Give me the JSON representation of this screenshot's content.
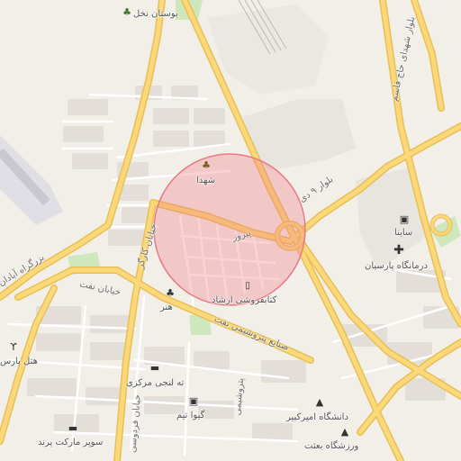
{
  "colors": {
    "land": "#f2efe9",
    "major_road": "#fbd97a",
    "major_road_edge": "#e6b94a",
    "minor_road": "#ffffff",
    "block": "#e3dfd8",
    "park": "#c9e6b3",
    "airport": "#e1dfe6",
    "radius_fill": "rgba(240,120,130,0.35)",
    "radius_stroke": "#e97b86"
  },
  "icons": {
    "park_icon": "tree-icon",
    "bookstore_icon": "book-icon",
    "store_icon": "shopping-bag-icon",
    "pharmacy_icon": "medical-cross-icon",
    "university_icon": "graduation-cap-icon",
    "restaurant_icon": "fork-knife-icon"
  },
  "places": {
    "bostan_nakhl": "بوستان نخل",
    "shohada": "شهدا",
    "honar": "هنر",
    "ketabforoushi_ershad": "کتابفروشی ارشاد",
    "sayna": "ساینا",
    "darmangah_parsian": "درمانگاه پارسیان",
    "hotel_pars": "هتل پارس",
    "tanaji_markazi": "ته لنجی مرکزی",
    "gio_team": "گیوا تیم",
    "super_market_parand": "سوپر مارکت پرند",
    "daneshgah_amirkabir": "دانشگاه امیرکبیر",
    "varzeshgah_besat": "ورزشگاه بعثت"
  },
  "roads": {
    "bolvar_shohadaye_ghasem": "بلوار شهدای حاج قاسم",
    "bolvar_9dey": "بلوار ۹ دی",
    "pirouz": "پیروز",
    "bozorgrah_abadan": "بزرگراه آبادان",
    "khiaban_naft": "خیابان نفت",
    "khiaban_kargar": "خیابان کارگر",
    "sanaye_petroshimi_naft": "صنایع پتروشیمی نفت",
    "khiaban_ferdowsi": "خیابان فردوسی",
    "petroshimi_street": "پتروشیمی"
  }
}
